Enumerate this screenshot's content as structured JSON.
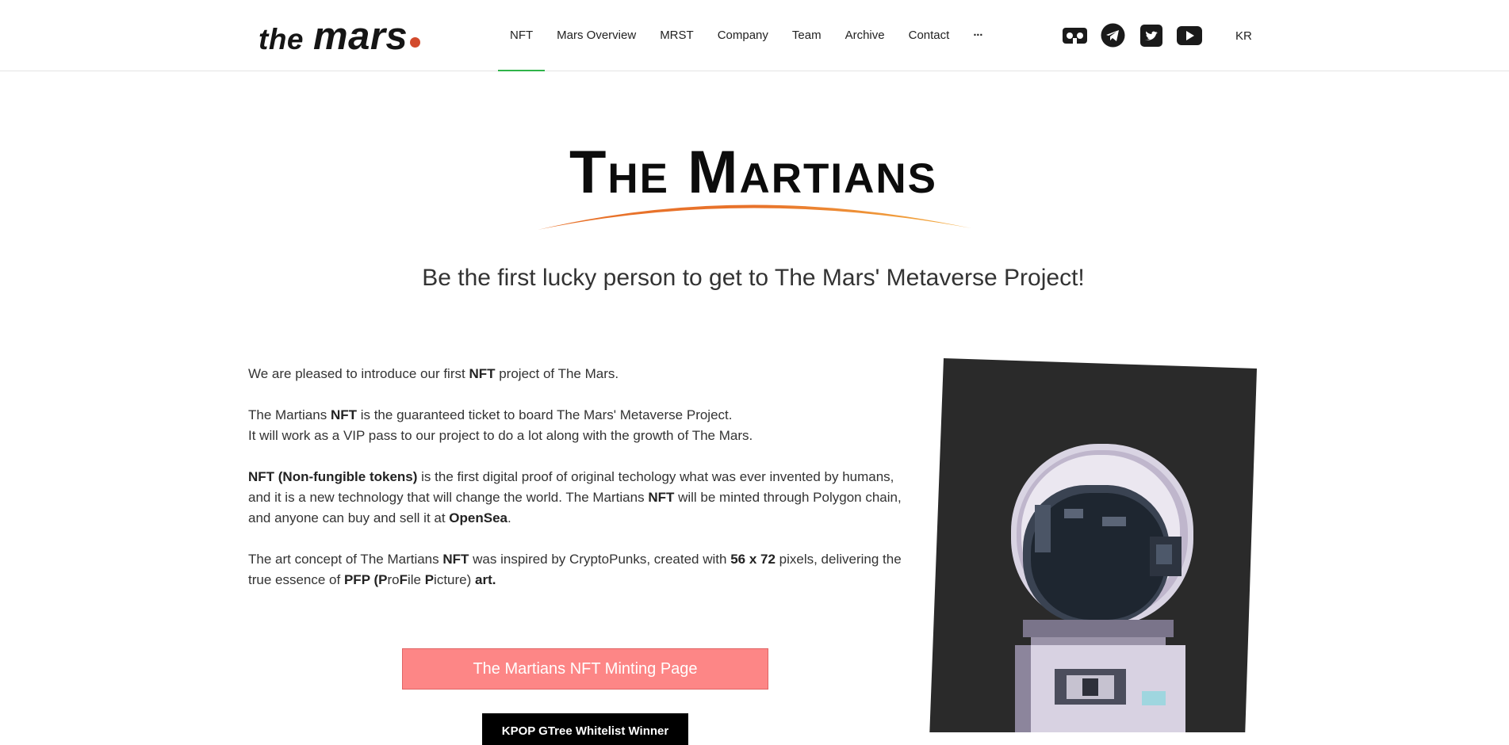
{
  "header": {
    "logo": {
      "the": "the",
      "mars": "mars",
      "dot_color": "#d24a2c"
    },
    "nav": [
      {
        "label": "NFT",
        "active": true
      },
      {
        "label": "Mars Overview"
      },
      {
        "label": "MRST"
      },
      {
        "label": "Company"
      },
      {
        "label": "Team"
      },
      {
        "label": "Archive"
      },
      {
        "label": "Contact"
      },
      {
        "label": "···"
      }
    ],
    "social_icons": [
      "vr-headset-icon",
      "telegram-icon",
      "twitter-icon",
      "youtube-icon"
    ],
    "lang": "KR"
  },
  "hero": {
    "title": "The Martians",
    "arc_colors": [
      "#e8722a",
      "#f4b044"
    ],
    "subtitle": "Be the first lucky person to get to The Mars' Metaverse Project!"
  },
  "content": {
    "p1": {
      "a": "We are pleased to introduce our first ",
      "b": "NFT",
      "c": " project of The Mars."
    },
    "p2": {
      "a": "The Martians ",
      "b": "NFT",
      "c": " is the guaranteed ticket to board The Mars' Metaverse Project.",
      "d": "It will work as a VIP pass to our project to do a lot along with the growth of The Mars."
    },
    "p3": {
      "a": "NFT (Non-fungible tokens)",
      "b": " is the first digital proof of original techology what was ever invented by humans,",
      "c": "and it is a new technology that will change the world. The Martians ",
      "d": "NFT",
      "e": " will be minted through Polygon chain,",
      "f": "and anyone can buy and sell it at ",
      "g": "OpenSea",
      "h": "."
    },
    "p4": {
      "a": "The art concept of The Martians ",
      "b": "NFT",
      "c": " was inspired by CryptoPunks, created with ",
      "d": "56 x 72",
      "e": " pixels, delivering the",
      "f": "true essence of ",
      "g": "PFP (P",
      "h": "ro",
      "i": "F",
      "j": "ile ",
      "k": "P",
      "l": "icture)",
      "m": " art."
    }
  },
  "buttons": {
    "mint": "The Martians NFT Minting Page",
    "whitelist": "KPOP GTree Whitelist Winner"
  },
  "nft_card": {
    "bg_color": "#2a2a2a"
  }
}
